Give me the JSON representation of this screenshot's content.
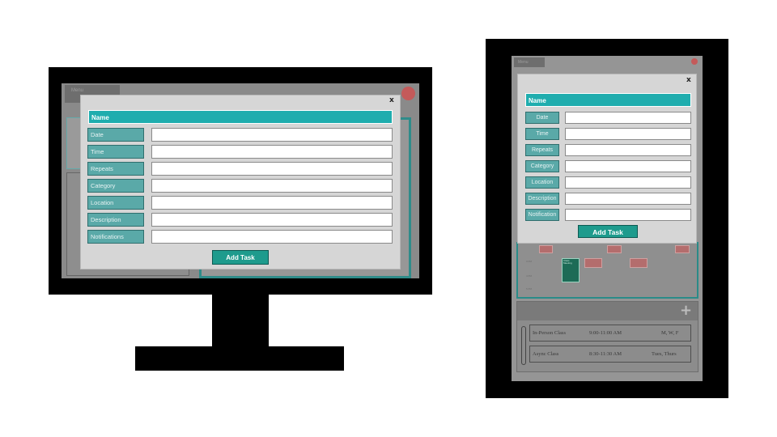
{
  "desktop": {
    "menu_label": "Menu",
    "modal": {
      "close_label": "x",
      "name_label": "Name",
      "fields": [
        "Date",
        "Time",
        "Repeats",
        "Category",
        "Location",
        "Description",
        "Notifications"
      ],
      "add_button": "Add Task"
    }
  },
  "tablet": {
    "menu_label": "Menu",
    "modal": {
      "close_label": "x",
      "name_label": "Name",
      "fields": [
        "Date",
        "Time",
        "Repeats",
        "Category",
        "Location",
        "Description",
        "Notification"
      ],
      "add_button": "Add Task"
    },
    "calendar": {
      "event_green": "Class Meeting"
    },
    "list": {
      "add_icon": "+",
      "rows": [
        {
          "name": "In-Person Class",
          "time": "9:00-11:00 AM",
          "days": "M, W, F"
        },
        {
          "name": "Async Class",
          "time": "8:30-11:30 AM",
          "days": "Tues, Thurs"
        }
      ]
    }
  },
  "colors": {
    "accent_teal": "#1fadae",
    "label_teal": "#5aa9a8",
    "button_green": "#1e9b8d",
    "status_red": "#c45a5a"
  }
}
